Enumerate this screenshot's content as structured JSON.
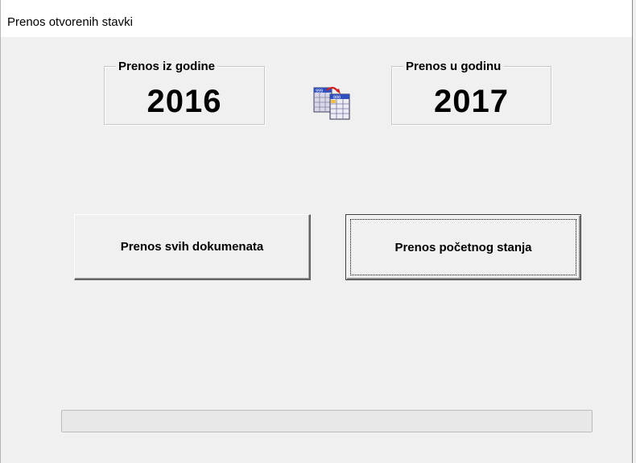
{
  "window": {
    "title": "Prenos otvorenih stavki"
  },
  "from_year": {
    "legend": "Prenos iz godine",
    "value": "2016"
  },
  "to_year": {
    "legend": "Prenos u godinu",
    "value": "2017"
  },
  "transfer_icon": "copy-table-icon",
  "buttons": {
    "transfer_all": "Prenos svih dokumenata",
    "transfer_opening": "Prenos početnog stanja"
  },
  "progress": {
    "value": 0
  }
}
